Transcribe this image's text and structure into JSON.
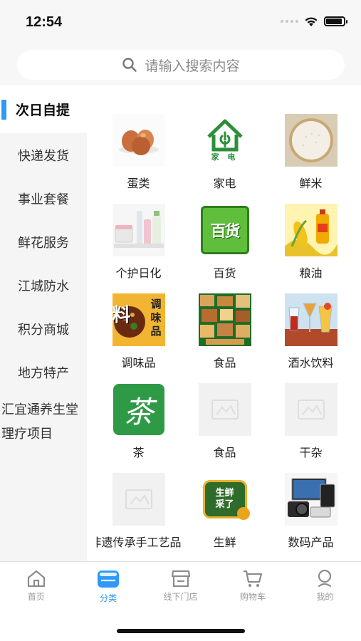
{
  "status": {
    "time": "12:54",
    "battery_level": 0.9
  },
  "search": {
    "placeholder": "请输入搜索内容"
  },
  "sidebar": {
    "active": "次日自提",
    "items": [
      {
        "label": "次日自提"
      },
      {
        "label": "快递发货"
      },
      {
        "label": "事业套餐"
      },
      {
        "label": "鲜花服务"
      },
      {
        "label": "江城防水"
      },
      {
        "label": "积分商城"
      },
      {
        "label": "地方特产"
      },
      {
        "label_line1": "汇宜通养生堂",
        "label_line2": "理疗项目"
      }
    ]
  },
  "categories": [
    {
      "label": "蛋类",
      "icon": "eggs-image"
    },
    {
      "label": "家电",
      "icon": "appliance-house-icon",
      "sub": "家 电"
    },
    {
      "label": "鲜米",
      "icon": "rice-image"
    },
    {
      "label": "个护日化",
      "icon": "cosmetics-image"
    },
    {
      "label": "百货",
      "icon": "department-store-icon",
      "sub": "百货"
    },
    {
      "label": "粮油",
      "icon": "grain-oil-image"
    },
    {
      "label": "调味品",
      "icon": "seasoning-image",
      "sub_big": "料",
      "sub_side": "调味品"
    },
    {
      "label": "食品",
      "icon": "food-collage-image"
    },
    {
      "label": "酒水饮料",
      "icon": "drinks-image"
    },
    {
      "label": "茶",
      "icon": "tea-icon",
      "sub": "茶"
    },
    {
      "label": "食品",
      "icon": "placeholder-image"
    },
    {
      "label": "干杂",
      "icon": "placeholder-image"
    },
    {
      "label": "非遗传承手工艺品",
      "icon": "placeholder-image"
    },
    {
      "label": "生鲜",
      "icon": "fresh-produce-icon",
      "sub": "生鲜采了"
    },
    {
      "label": "数码产品",
      "icon": "electronics-image"
    }
  ],
  "tabbar": {
    "active": "分类",
    "tabs": [
      {
        "label": "首页",
        "icon": "home-icon"
      },
      {
        "label": "分类",
        "icon": "category-icon"
      },
      {
        "label": "线下门店",
        "icon": "store-icon"
      },
      {
        "label": "购物车",
        "icon": "cart-icon"
      },
      {
        "label": "我的",
        "icon": "profile-icon"
      }
    ]
  },
  "colors": {
    "accent": "#2e9af7",
    "green": "#2d8f3a",
    "text": "#222222",
    "muted": "#9a9a9a"
  }
}
